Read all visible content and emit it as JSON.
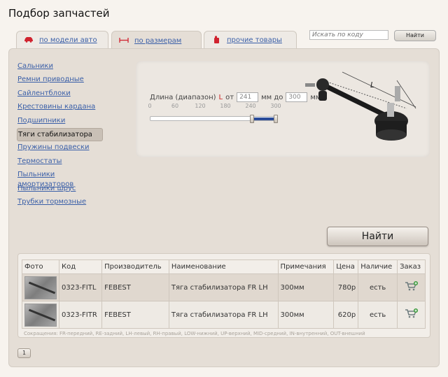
{
  "page": {
    "title": "Подбор запчастей"
  },
  "tabs": [
    {
      "label": "по модели авто",
      "icon": "car-icon"
    },
    {
      "label": "по размерам",
      "icon": "dimension-icon"
    },
    {
      "label": "прочие товары",
      "icon": "canister-icon"
    }
  ],
  "active_tab": "по размерам",
  "search": {
    "placeholder": "Искать по коду",
    "button_label": "Найти"
  },
  "categories": [
    "Сальники",
    "Ремни приводные",
    "Сайлентблоки",
    "Крестовины кардана",
    "Подшипники",
    "Тяги стабилизатора",
    "Пружины подвески",
    "Термостаты",
    "Пыльники амортизаторов",
    "Пыльники шрус",
    "Трубки тормозные"
  ],
  "selected_category": "Тяги стабилизатора",
  "size_filter": {
    "label": "Длина (диапазон)",
    "param": "L",
    "from_label": "от",
    "from_value": "241",
    "to_label": "мм до",
    "to_value": "300",
    "unit": "мм",
    "ticks": [
      "0",
      "60",
      "120",
      "180",
      "240",
      "300"
    ],
    "range_min": 0,
    "range_max": 300,
    "selected_min": 241,
    "selected_max": 300,
    "diagram_label": "L"
  },
  "find_button": "Найти",
  "results": {
    "columns": [
      "Фото",
      "Код",
      "Производитель",
      "Наименование",
      "Примечания",
      "Цена",
      "Наличие",
      "Заказ"
    ],
    "rows": [
      {
        "code": "0323-FITL",
        "maker": "FEBEST",
        "name": "Тяга стабилизатора FR LH",
        "note": "300мм",
        "price": "780р",
        "stock": "есть"
      },
      {
        "code": "0323-FITR",
        "maker": "FEBEST",
        "name": "Тяга стабилизатора FR LH",
        "note": "300мм",
        "price": "620р",
        "stock": "есть"
      }
    ],
    "abbreviations": "Сокращения: FR-передний, RE-задний, LH-левый, RH-правый, LOW-нижний, UP-верхний, MID-средний, IN-внутренний, OUT-внешний"
  },
  "pagination": {
    "current": "1"
  },
  "colors": {
    "link": "#3a5fa8",
    "accent": "#d0232f",
    "panel": "#e5ded6",
    "slider_fill": "#2a4b99"
  }
}
